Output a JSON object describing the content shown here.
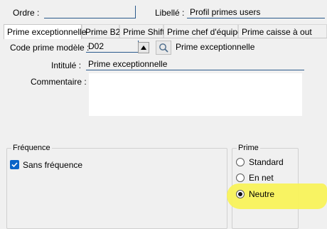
{
  "header": {
    "ordre_label": "Ordre :",
    "ordre_value": "",
    "libelle_label": "Libellé :",
    "libelle_value": "Profil primes users"
  },
  "tabs": [
    {
      "label": "Prime exceptionnelle",
      "active": true
    },
    {
      "label": "Prime B2",
      "active": false
    },
    {
      "label": "Prime Shift",
      "active": false
    },
    {
      "label": "Prime chef d'équipe",
      "active": false
    },
    {
      "label": "Prime caisse à out",
      "active": false
    }
  ],
  "form": {
    "code_label": "Code prime modèle :",
    "code_value": "D02",
    "code_description": "Prime exceptionnelle",
    "intitule_label": "Intitulé :",
    "intitule_value": "Prime exceptionnelle",
    "commentaire_label": "Commentaire :",
    "commentaire_value": ""
  },
  "frequence": {
    "legend": "Fréquence",
    "sans_frequence_label": "Sans fréquence",
    "sans_frequence_checked": true
  },
  "prime": {
    "legend": "Prime",
    "options": [
      {
        "label": "Standard",
        "selected": false
      },
      {
        "label": "En net",
        "selected": false
      },
      {
        "label": "Neutre",
        "selected": true
      }
    ]
  },
  "icons": {
    "spin": "triangle-up-icon",
    "search": "magnifier-icon",
    "check": "checkmark-icon"
  },
  "colors": {
    "accent": "#0a64c8",
    "highlight": "#f8f25a"
  }
}
